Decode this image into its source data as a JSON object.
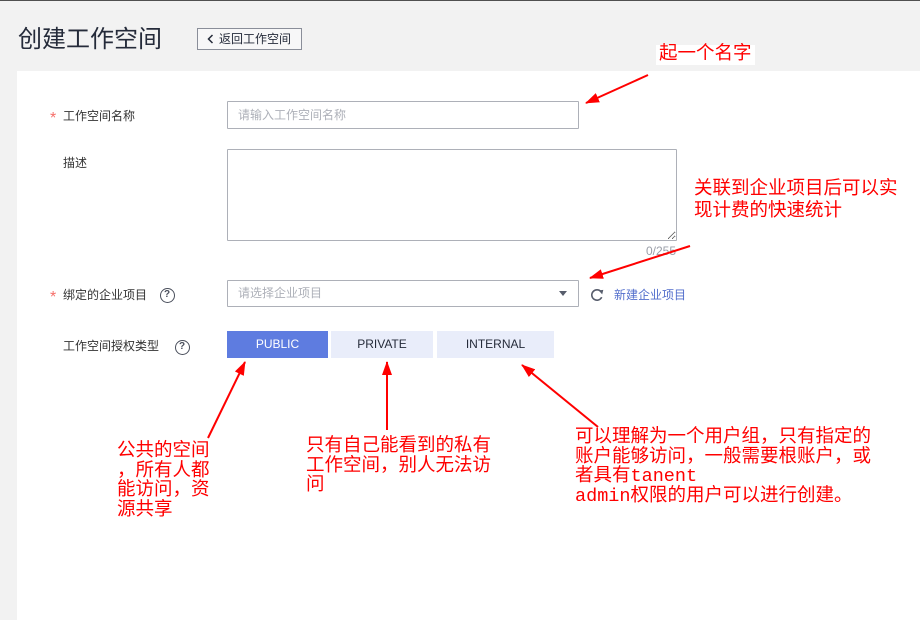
{
  "page": {
    "title": "创建工作空间",
    "back_button": {
      "label": "返回工作空间",
      "icon": "chevron-left-icon"
    }
  },
  "form": {
    "workspace_name": {
      "required_mark": "*",
      "label": "工作空间名称",
      "value": "",
      "placeholder": "请输入工作空间名称"
    },
    "description": {
      "label": "描述",
      "value": "",
      "counter": "0/255"
    },
    "enterprise_project": {
      "required_mark": "*",
      "label": "绑定的企业项目",
      "help_icon": {
        "name": "help-icon",
        "glyph": "?"
      },
      "placeholder": "请选择企业项目",
      "dropdown_icon": "caret-down-icon",
      "refresh_icon": "refresh-icon",
      "create_link": "新建企业项目"
    },
    "auth_type": {
      "label": "工作空间授权类型",
      "help_icon": {
        "name": "help-icon",
        "glyph": "?"
      },
      "options": [
        {
          "label": "PUBLIC",
          "selected": true
        },
        {
          "label": "PRIVATE",
          "selected": false
        },
        {
          "label": "INTERNAL",
          "selected": false
        }
      ]
    }
  },
  "annotations": {
    "name_hint": [
      "起一个名字"
    ],
    "enterprise_project_hint": [
      "关联到企业项目后可以实",
      "现计费的快速统计"
    ],
    "public_hint": [
      "公共的空间",
      "，所有人都",
      "能访问，资",
      "源共享"
    ],
    "private_hint": [
      "只有自己能看到的私有",
      "工作空间，别人无法访",
      "问"
    ],
    "internal_hint": [
      "可以理解为一个用户组，只有指定的",
      "账户能够访问，一般需要根账户，或",
      "者具有tanent",
      "admin权限的用户可以进行创建。"
    ]
  },
  "colors": {
    "accent": "#5e7ce0",
    "option_bg": "#e9edfa",
    "link": "#526ecc",
    "required": "#f66f6a",
    "annotation": "#ff0000"
  }
}
